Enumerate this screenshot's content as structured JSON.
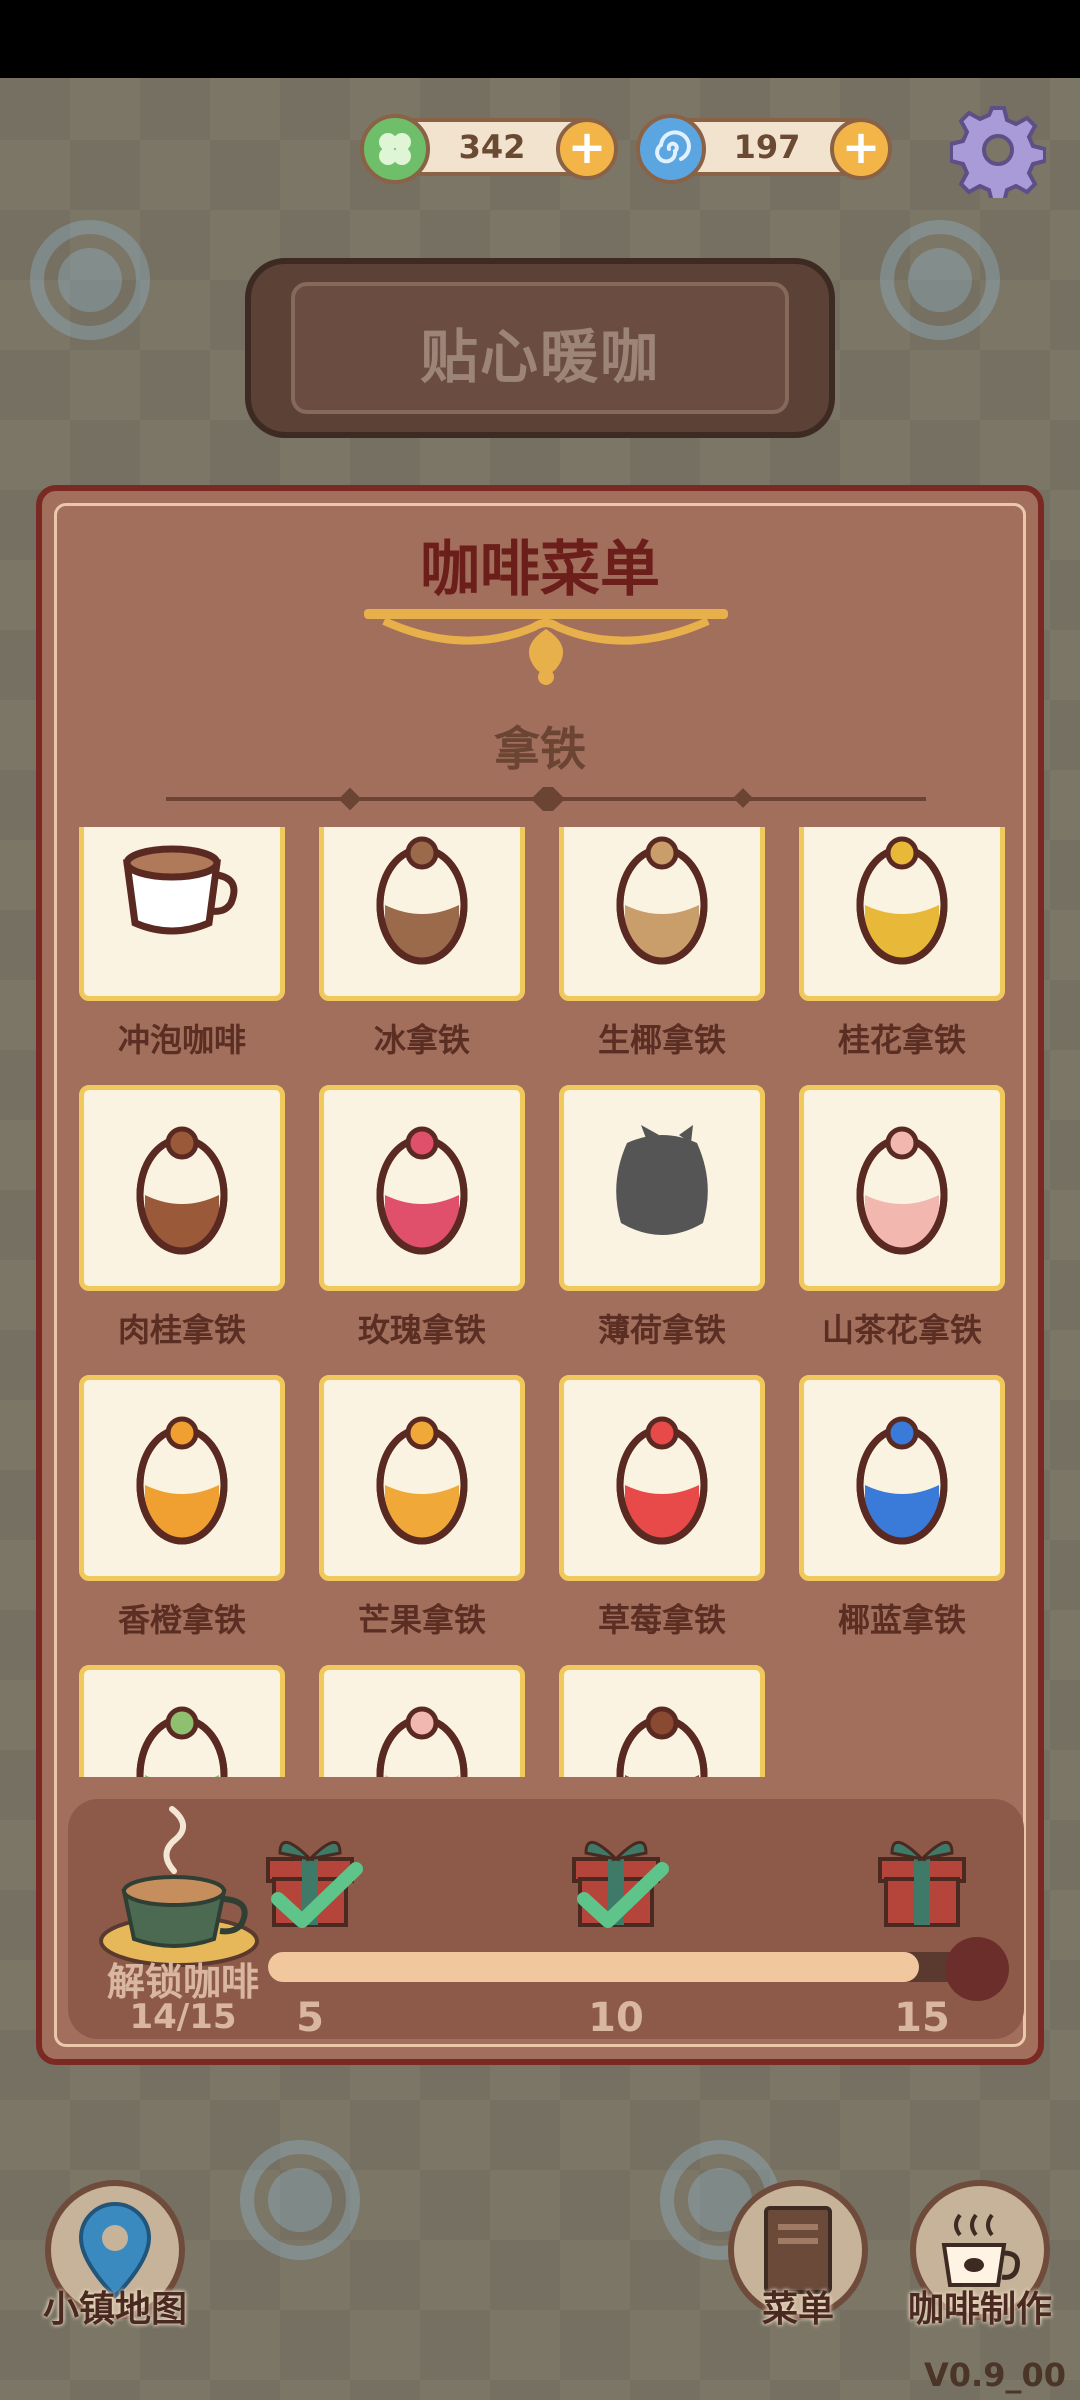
{
  "currency": [
    {
      "name": "clover",
      "value": "342",
      "color": "#6fbf6a"
    },
    {
      "name": "swirl",
      "value": "197",
      "color": "#5ba6e0"
    }
  ],
  "shop": {
    "title": "贴心暖咖"
  },
  "menu": {
    "title": "咖啡菜单",
    "category": "拿铁",
    "items": [
      {
        "label": "冲泡咖啡",
        "icon": "cup-icon",
        "color": "#b07a5a"
      },
      {
        "label": "冰拿铁",
        "icon": "jar-icon",
        "color": "#9a6a4a"
      },
      {
        "label": "生椰拿铁",
        "icon": "jar-icon",
        "color": "#c99e6a"
      },
      {
        "label": "桂花拿铁",
        "icon": "jar-icon",
        "color": "#e8b938"
      },
      {
        "label": "肉桂拿铁",
        "icon": "jar-icon",
        "color": "#9a5a3a"
      },
      {
        "label": "玫瑰拿铁",
        "icon": "jar-icon",
        "color": "#e0506a"
      },
      {
        "label": "薄荷拿铁",
        "icon": "locked-icon",
        "color": "#555555"
      },
      {
        "label": "山茶花拿铁",
        "icon": "jar-icon",
        "color": "#f2b8b0"
      },
      {
        "label": "香橙拿铁",
        "icon": "jar-icon",
        "color": "#f0a030"
      },
      {
        "label": "芒果拿铁",
        "icon": "jar-icon",
        "color": "#f0a838"
      },
      {
        "label": "草莓拿铁",
        "icon": "jar-icon",
        "color": "#e84a4a"
      },
      {
        "label": "椰蓝拿铁",
        "icon": "jar-icon",
        "color": "#3a7ad8"
      },
      {
        "label": "",
        "icon": "jar-icon",
        "color": "#8fc070"
      },
      {
        "label": "",
        "icon": "jar-icon",
        "color": "#f0b8b0"
      },
      {
        "label": "",
        "icon": "jar-icon",
        "color": "#8a4a32"
      }
    ]
  },
  "progress": {
    "label": "解锁咖啡",
    "count": "14/15",
    "fraction": 0.93,
    "milestones": [
      {
        "value": "5",
        "claimed": true
      },
      {
        "value": "10",
        "claimed": true
      },
      {
        "value": "15",
        "claimed": false
      }
    ]
  },
  "nav": {
    "map_label": "小镇地图",
    "menu_label": "菜单",
    "make_label": "咖啡制作"
  },
  "version": "V0.9_00"
}
